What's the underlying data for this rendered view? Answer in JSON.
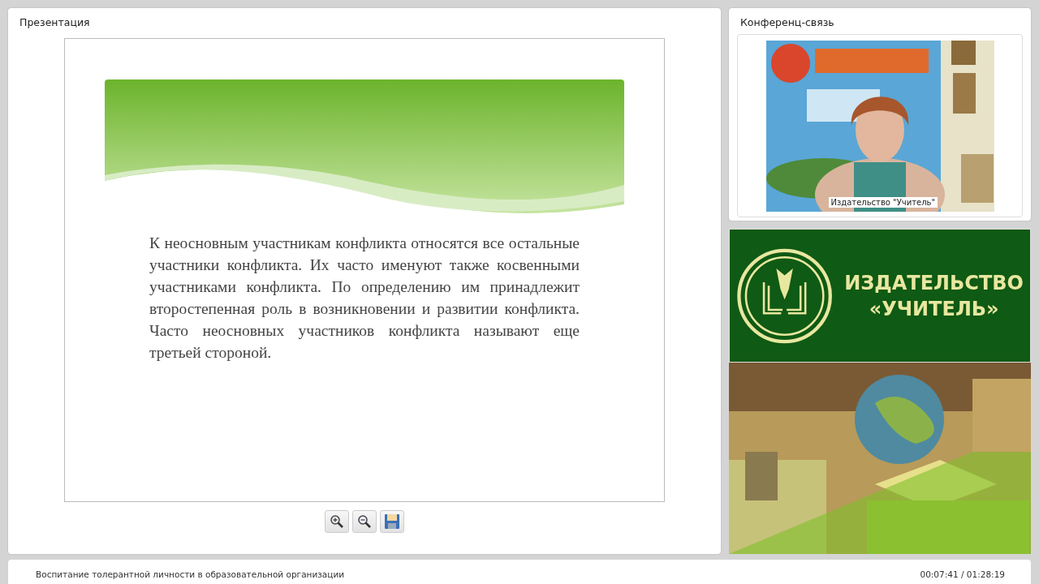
{
  "presentation": {
    "title": "Презентация",
    "slide": {
      "text": "К неосновным участникам конфликта относятся все остальные участники конфликта. Их часто именуют также косвенными участниками конфликта. По определению им принадлежит второстепенная роль в возникновении и развитии конфликта. Часто неосновных участников конфликта называют еще третьей стороной."
    },
    "toolbar": [
      {
        "kind": "zoom-in"
      },
      {
        "kind": "zoom-out"
      },
      {
        "kind": "save"
      }
    ]
  },
  "conference": {
    "title": "Конференц-связь",
    "caption": "Издательство \"Учитель\""
  },
  "banner": {
    "lines": [
      "ИЗДАТЕЛЬСТВО",
      "«УЧИТЕЛЬ»"
    ]
  },
  "status_bar": {
    "title": "Воспитание толерантной личности в образовательной организации",
    "time": "00:07:41 / 01:28:19"
  }
}
